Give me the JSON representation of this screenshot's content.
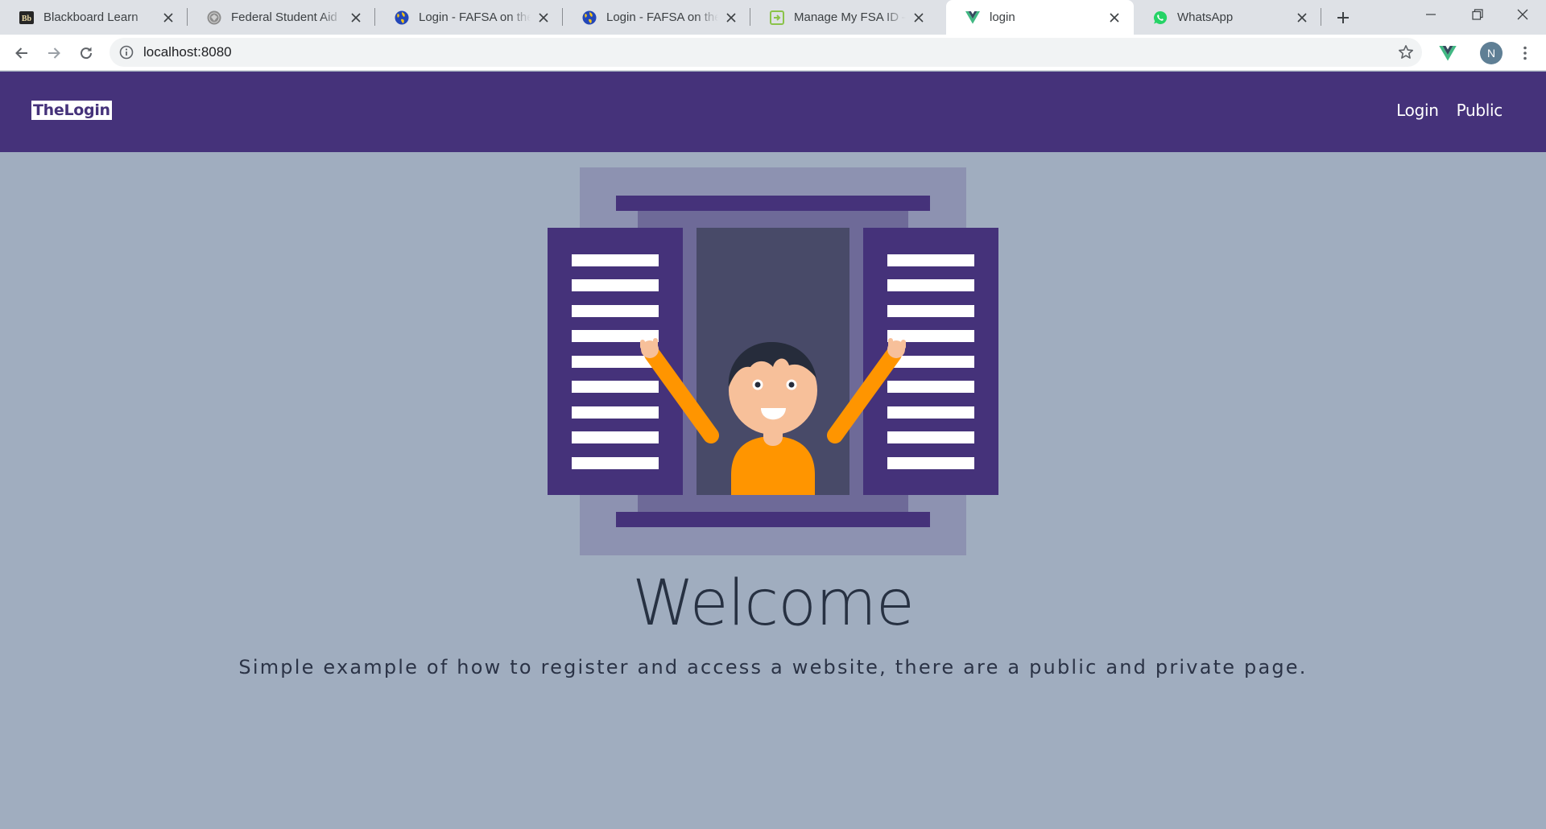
{
  "browser": {
    "tabs": [
      {
        "title": "Blackboard Learn",
        "icon": "blackboard-icon",
        "active": false
      },
      {
        "title": "Federal Student Aid",
        "icon": "seal-icon",
        "active": false
      },
      {
        "title": "Login - FAFSA on the Web",
        "icon": "globe-icon",
        "active": false
      },
      {
        "title": "Login - FAFSA on the Web",
        "icon": "globe-icon",
        "active": false
      },
      {
        "title": "Manage My FSA ID – My FSA",
        "icon": "fsa-icon",
        "active": false
      },
      {
        "title": "login",
        "icon": "vue-icon",
        "active": true
      },
      {
        "title": "WhatsApp",
        "icon": "whatsapp-icon",
        "active": false
      }
    ],
    "url": "localhost:8080",
    "profile_initial": "N",
    "colors": {
      "tab_strip": "#dee1e6",
      "vue_green": "#41b883",
      "vue_dark": "#35495e",
      "whatsapp_green": "#25d366"
    }
  },
  "navbar": {
    "brand": "TheLogin",
    "links": [
      "Login",
      "Public"
    ],
    "background": "#45327a"
  },
  "hero": {
    "title": "Welcome",
    "subtitle": "Simple example of how to register and access a website, there are a public and private page.",
    "background": "#a0adbf",
    "illustration": "person-waving-from-window-illustration"
  }
}
